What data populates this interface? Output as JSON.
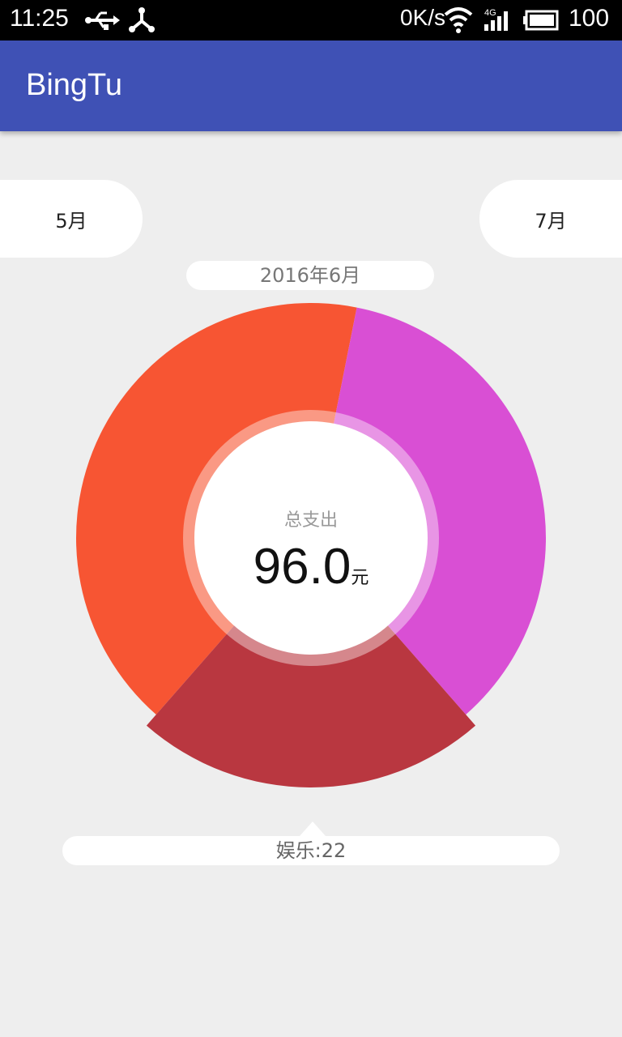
{
  "status_bar": {
    "time": "11:25",
    "net_speed": "0K/s",
    "battery": "100",
    "icons": [
      "usb-icon",
      "share-icon",
      "wifi-icon",
      "signal-4g-icon",
      "battery-icon"
    ]
  },
  "app_bar": {
    "title": "BingTu"
  },
  "nav": {
    "prev_month": "5月",
    "next_month": "7月"
  },
  "current_period": "2016年6月",
  "center": {
    "label": "总支出",
    "value": "96.0",
    "unit": "元"
  },
  "selected_info": "娱乐:22",
  "colors": {
    "primary": "#3f51b5",
    "background": "#eeeeee"
  },
  "chart_data": {
    "type": "pie",
    "style": "donut",
    "total": 96.0,
    "slices": [
      {
        "value": 40,
        "color": "#f75533"
      },
      {
        "value": 34,
        "color": "#d94fd4"
      },
      {
        "label": "娱乐",
        "value": 22,
        "color": "#b93740",
        "selected": true
      }
    ]
  }
}
